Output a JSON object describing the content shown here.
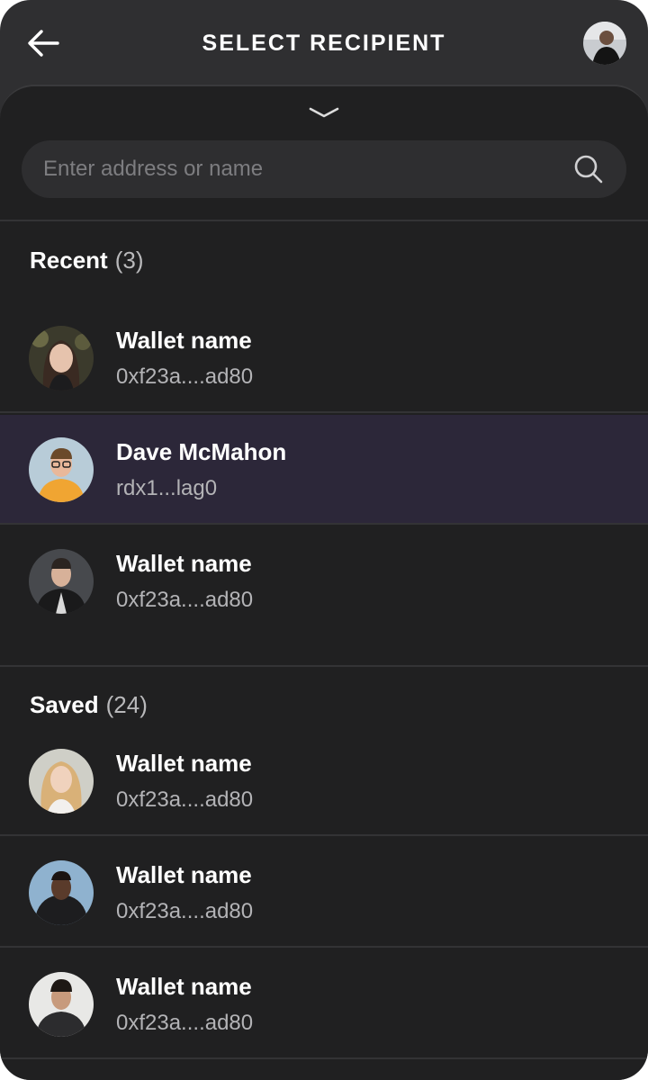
{
  "header": {
    "title": "SELECT RECIPIENT",
    "back_icon": "arrow-left-icon",
    "profile_avatar": "user-avatar"
  },
  "sheet": {
    "collapse_icon": "chevron-down-icon"
  },
  "search": {
    "placeholder": "Enter address or name",
    "value": "",
    "icon": "search-icon"
  },
  "recent": {
    "label": "Recent",
    "count": "(3)",
    "items": [
      {
        "name": "Wallet name",
        "address": "0xf23a....ad80",
        "selected": false
      },
      {
        "name": "Dave McMahon",
        "address": "rdx1...lag0",
        "selected": true
      },
      {
        "name": "Wallet name",
        "address": "0xf23a....ad80",
        "selected": false
      }
    ]
  },
  "saved": {
    "label": "Saved",
    "count": "(24)",
    "items": [
      {
        "name": "Wallet name",
        "address": "0xf23a....ad80"
      },
      {
        "name": "Wallet name",
        "address": "0xf23a....ad80"
      },
      {
        "name": "Wallet name",
        "address": "0xf23a....ad80"
      }
    ]
  },
  "colors": {
    "background": "#2f2f31",
    "sheet": "#202021",
    "selected_row": "#2c2739",
    "primary_text": "#ffffff",
    "secondary_text": "#b3b3b6"
  }
}
